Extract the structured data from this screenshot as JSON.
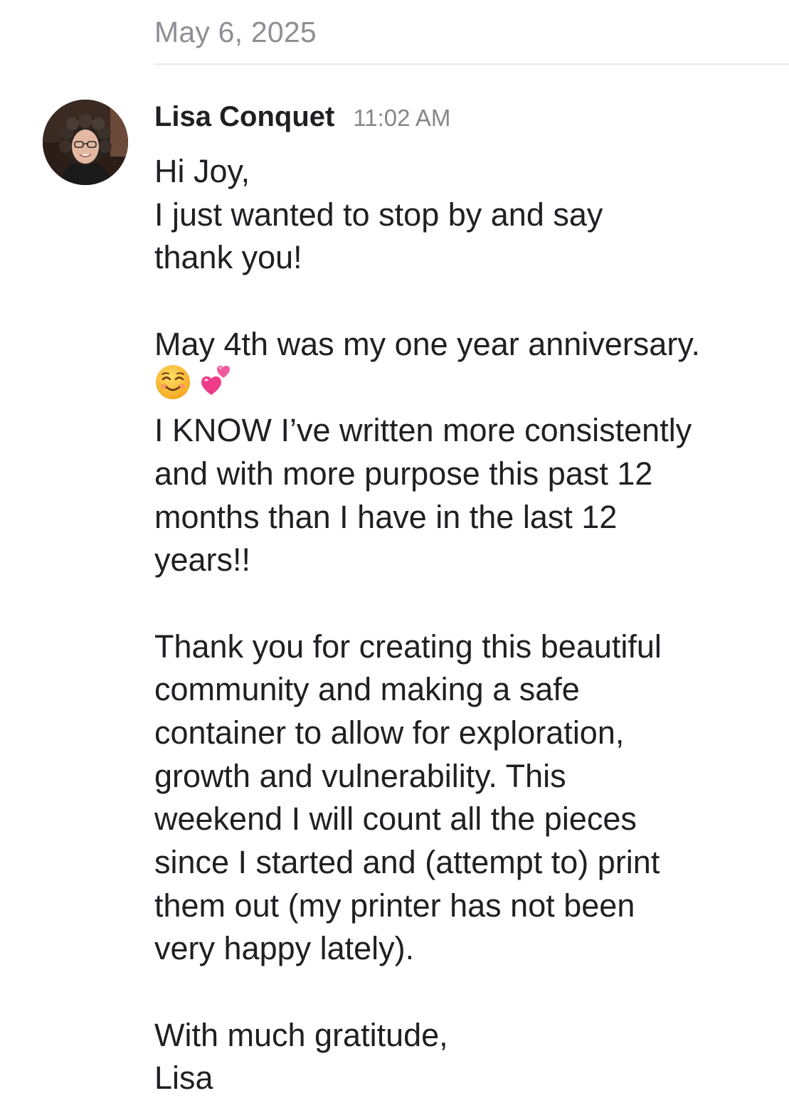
{
  "date_separator": "May 6, 2025",
  "message": {
    "sender": "Lisa Conquet",
    "time": "11:02 AM",
    "lines": {
      "l1": "Hi Joy,",
      "l2": "I just wanted to stop by and say",
      "l3": "thank you!",
      "l4": "May 4th was my one year anniversary.",
      "l5": "I KNOW I’ve written more consistently",
      "l6": "and with more purpose this past 12",
      "l7": "months than I have in the last 12",
      "l8": "years!!",
      "l9": "Thank you for creating this beautiful",
      "l10": "community and making a safe",
      "l11": "container to allow for exploration,",
      "l12": "growth and vulnerability. This",
      "l13": "weekend I will count all the pieces",
      "l14": "since I started and (attempt to) print",
      "l15": "them out (my printer has not been",
      "l16": "very happy lately).",
      "l17": "With much gratitude,",
      "l18": "Lisa"
    },
    "emojis": [
      "smiling-face-icon",
      "two-hearts-icon"
    ]
  }
}
